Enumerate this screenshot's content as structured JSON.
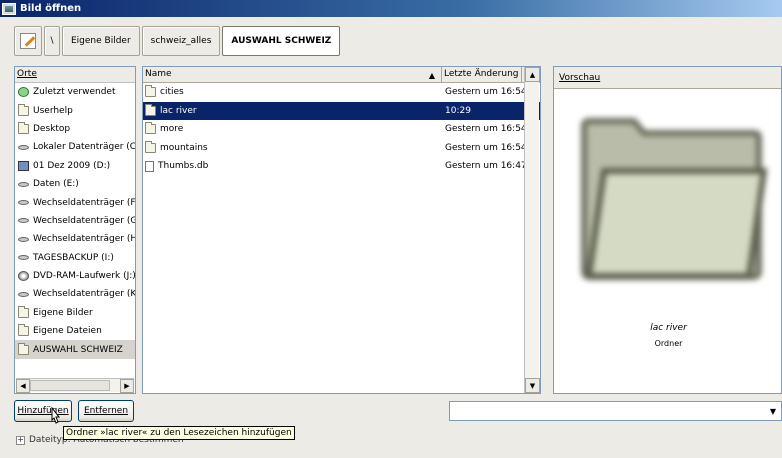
{
  "window": {
    "title": "Bild öffnen"
  },
  "pathbar": {
    "root": "\\",
    "segments": [
      "Eigene Bilder",
      "schweiz_alles",
      "AUSWAHL SCHWEIZ"
    ]
  },
  "places": {
    "header": "Orte",
    "items": [
      {
        "label": "Zuletzt verwendet",
        "icon": "recent-icon"
      },
      {
        "label": "Userhelp",
        "icon": "folder-icon"
      },
      {
        "label": "Desktop",
        "icon": "folder-icon"
      },
      {
        "label": "Lokaler Datenträger (C:)",
        "icon": "drive-icon"
      },
      {
        "label": "01 Dez 2009 (D:)",
        "icon": "removable-drive-icon"
      },
      {
        "label": "Daten (E:)",
        "icon": "drive-icon"
      },
      {
        "label": "Wechseldatenträger (F:)",
        "icon": "drive-icon"
      },
      {
        "label": "Wechseldatenträger (G:)",
        "icon": "drive-icon"
      },
      {
        "label": "Wechseldatenträger (H:)",
        "icon": "drive-icon"
      },
      {
        "label": "TAGESBACKUP (I:)",
        "icon": "drive-icon"
      },
      {
        "label": "DVD-RAM-Laufwerk (J:)",
        "icon": "cdrom-icon"
      },
      {
        "label": "Wechseldatenträger (K:)",
        "icon": "drive-icon"
      },
      {
        "label": "Eigene Bilder",
        "icon": "folder-icon"
      },
      {
        "label": "Eigene Dateien",
        "icon": "folder-icon"
      },
      {
        "label": "AUSWAHL SCHWEIZ",
        "icon": "folder-icon"
      }
    ]
  },
  "files": {
    "columns": {
      "name": "Name",
      "modified": "Letzte Änderung"
    },
    "rows": [
      {
        "name": "cities",
        "modified": "Gestern um 16:54",
        "icon": "folder-icon"
      },
      {
        "name": "lac river",
        "modified": "10:29",
        "icon": "folder-icon"
      },
      {
        "name": "more",
        "modified": "Gestern um 16:54",
        "icon": "folder-icon"
      },
      {
        "name": "mountains",
        "modified": "Gestern um 16:54",
        "icon": "folder-icon"
      },
      {
        "name": "Thumbs.db",
        "modified": "Gestern um 16:47",
        "icon": "file-icon"
      }
    ],
    "selected_index": 1
  },
  "preview": {
    "header": "Vorschau",
    "name": "lac river",
    "type": "Ordner"
  },
  "buttons": {
    "add": "Hinzufügen",
    "remove": "Entfernen"
  },
  "tooltip": "Ordner »lac river« zu den Lesezeichen hinzufügen",
  "filetype": {
    "label": "Dateityp: Automatisch bestimmen"
  },
  "filter": {
    "value": ""
  }
}
